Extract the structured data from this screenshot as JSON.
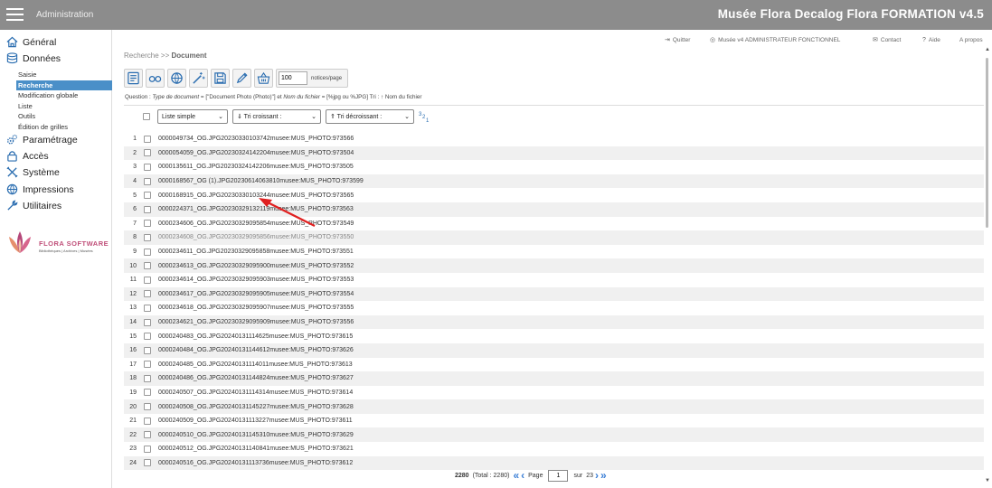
{
  "topbar": {
    "admin_label": "Administration",
    "app_title": "Musée Flora Decalog Flora FORMATION v4.5"
  },
  "sidebar": {
    "general": "Général",
    "donnees": "Données",
    "submenu": [
      "Saisie",
      "Recherche",
      "Modification globale",
      "Liste",
      "Outils",
      "Édition de grilles"
    ],
    "active_submenu": "Recherche",
    "parametrage": "Paramétrage",
    "acces": "Accès",
    "systeme": "Système",
    "impressions": "Impressions",
    "utilitaires": "Utilitaires",
    "logo_text": "FLORA SOFTWARE",
    "logo_sub": "Bibliothèques | Archives | Musées"
  },
  "utility": {
    "quit": "Quitter",
    "user": "Musée v4 ADMINISTRATEUR FONCTIONNEL",
    "contact": "Contact",
    "help": "Aide",
    "about": "A propos"
  },
  "breadcrumb": {
    "parent": "Recherche >> ",
    "current": "Document"
  },
  "toolbar": {
    "per_page_value": "100",
    "per_page_label": "notices/page"
  },
  "query": {
    "prefix": "Question : ",
    "field1": "Type de document",
    "op1": " = [\"Document Photo (Photo)\"] et ",
    "field2": "Nom du fichier",
    "op2": " = [%jpg ou %JPG]   Tri : ↑ Nom du fichier"
  },
  "controls": {
    "list_mode": "Liste simple",
    "sort_asc": "⇓ Tri croissant :",
    "sort_desc": "⇑ Tri décroissant :"
  },
  "results": [
    "0000049734_OG.JPG20230330103742musee:MUS_PHOTO:973566",
    "0000054059_OG.JPG20230324142204musee:MUS_PHOTO:973504",
    "0000135611_OG.JPG20230324142206musee:MUS_PHOTO:973505",
    "0000168567_OG (1).JPG20230614063810musee:MUS_PHOTO:973599",
    "0000168915_OG.JPG20230330103244musee:MUS_PHOTO:973565",
    "0000224371_OG.JPG20230329132119musee:MUS_PHOTO:973563",
    "0000234606_OG.JPG20230329095854musee:MUS_PHOTO:973549",
    "0000234608_OG.JPG20230329095856musee:MUS_PHOTO:973550",
    "0000234611_OG.JPG20230329095858musee:MUS_PHOTO:973551",
    "0000234613_OG.JPG20230329095900musee:MUS_PHOTO:973552",
    "0000234614_OG.JPG20230329095903musee:MUS_PHOTO:973553",
    "0000234617_OG.JPG20230329095905musee:MUS_PHOTO:973554",
    "0000234618_OG.JPG20230329095907musee:MUS_PHOTO:973555",
    "0000234621_OG.JPG20230329095909musee:MUS_PHOTO:973556",
    "0000240483_OG.JPG20240131114625musee:MUS_PHOTO:973615",
    "0000240484_OG.JPG20240131144612musee:MUS_PHOTO:973626",
    "0000240485_OG.JPG20240131114011musee:MUS_PHOTO:973613",
    "0000240486_OG.JPG20240131144824musee:MUS_PHOTO:973627",
    "0000240507_OG.JPG20240131114314musee:MUS_PHOTO:973614",
    "0000240508_OG.JPG20240131145227musee:MUS_PHOTO:973628",
    "0000240509_OG.JPG20240131113227musee:MUS_PHOTO:973611",
    "0000240510_OG.JPG20240131145310musee:MUS_PHOTO:973629",
    "0000240512_OG.JPG20240131140841musee:MUS_PHOTO:973621",
    "0000240516_OG.JPG20240131113736musee:MUS_PHOTO:973612"
  ],
  "pager": {
    "count": "2280",
    "total": "(Total : 2280)",
    "page_label": "Page",
    "page_value": "1",
    "of_label": "sur",
    "total_pages": "23"
  },
  "colors": {
    "topbar": "#8c8c8c",
    "active": "#4a8fc8",
    "icon_blue": "#2a6db0",
    "arrow_red": "#e02020"
  }
}
